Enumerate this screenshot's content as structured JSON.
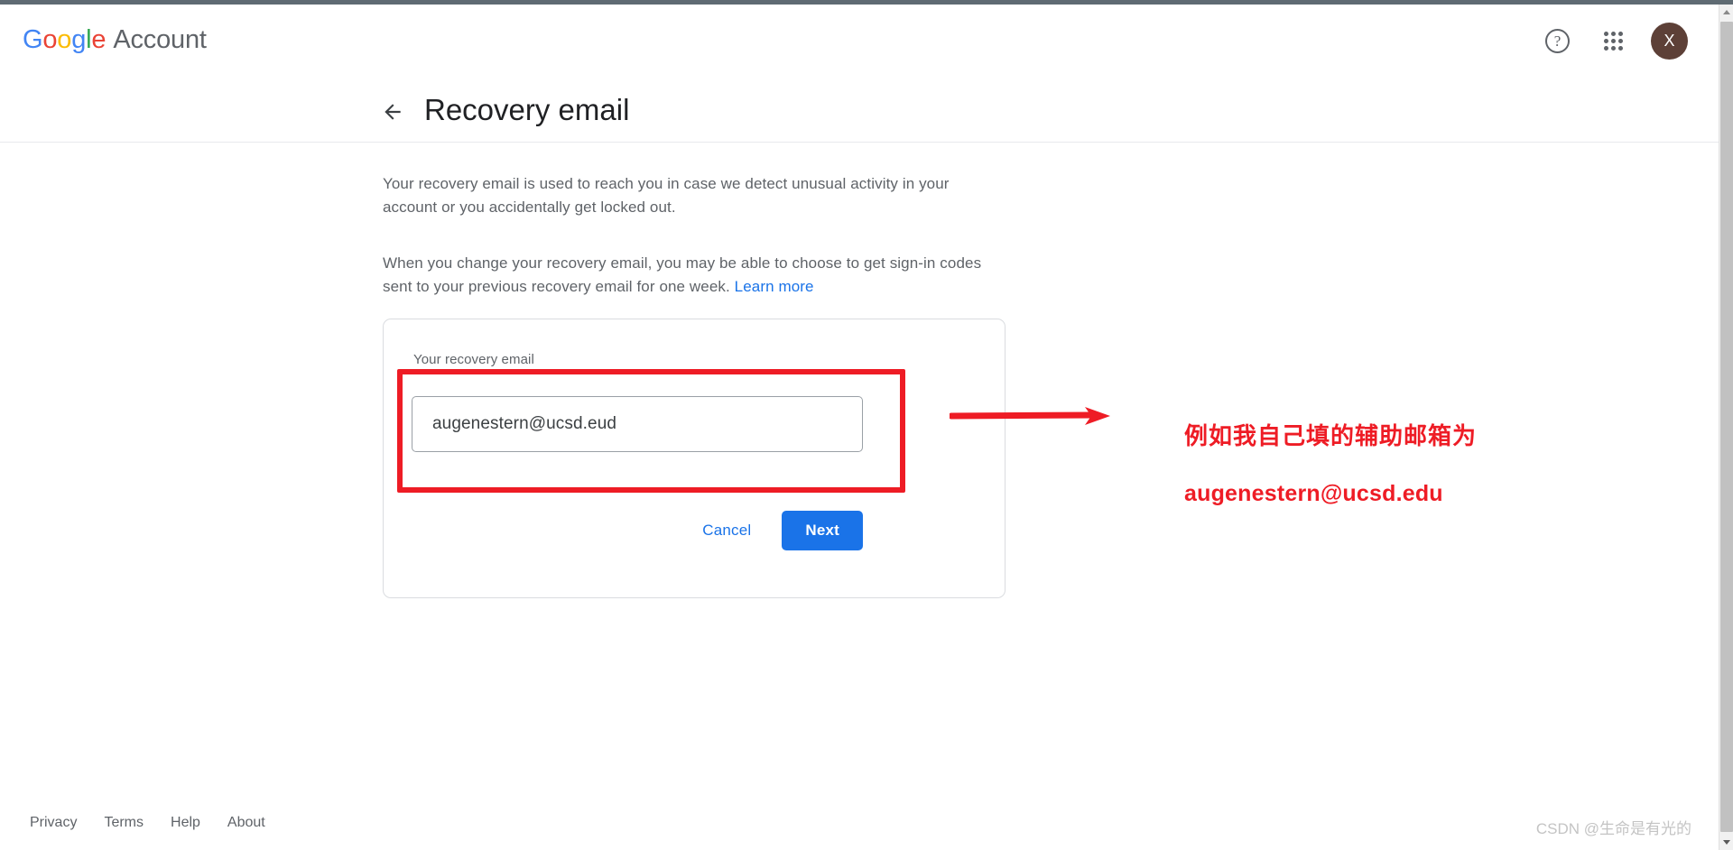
{
  "browser": {
    "scrollbar": {
      "up_arrow_icon": "triangle-up-icon",
      "down_arrow_icon": "triangle-down-icon"
    }
  },
  "header": {
    "brand": {
      "logo_letters": [
        "G",
        "o",
        "o",
        "g",
        "l",
        "e"
      ],
      "logo_colors": [
        "#4285f4",
        "#ea4335",
        "#fbbc05",
        "#4285f4",
        "#34a853",
        "#ea4335"
      ],
      "word": "Account"
    },
    "actions": {
      "help_icon": "question-mark-icon",
      "help_label": "?",
      "apps_icon": "apps-grid-icon",
      "avatar_initial": "X",
      "avatar_color": "#5d4037"
    }
  },
  "page": {
    "back_icon": "arrow-left-icon",
    "title": "Recovery email",
    "paragraph_1": "Your recovery email is used to reach you in case we detect unusual activity in your account or you accidentally get locked out.",
    "paragraph_2_prefix": "When you change your recovery email, you may be able to choose to get sign-in codes sent to your previous recovery email for one week. ",
    "learn_more_label": "Learn more"
  },
  "card": {
    "field_label": "Your recovery email",
    "input_value": "augenestern@ucsd.eud",
    "input_placeholder": "Enter recovery email",
    "cancel_label": "Cancel",
    "next_label": "Next",
    "primary_color": "#1a73e8"
  },
  "annotation": {
    "color": "#ee1c25",
    "arrow_icon": "arrow-right-annotation-icon",
    "line_1": "例如我自己填的辅助邮箱为",
    "line_2": "augenestern@ucsd.edu"
  },
  "footer": {
    "links": [
      {
        "label": "Privacy"
      },
      {
        "label": "Terms"
      },
      {
        "label": "Help"
      },
      {
        "label": "About"
      }
    ]
  },
  "watermark": {
    "text": "CSDN @生命是有光的"
  }
}
